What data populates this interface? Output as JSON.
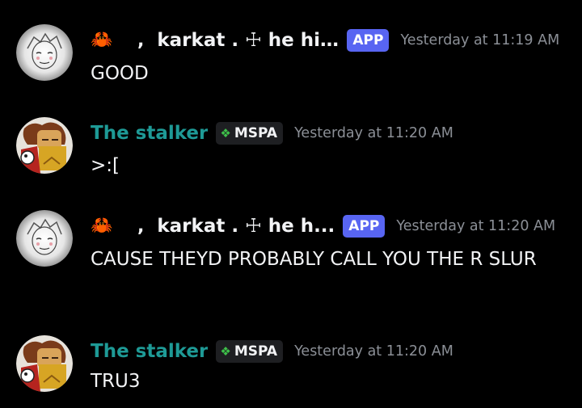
{
  "messages": [
    {
      "author": "karkat . ☩ he hi...",
      "crab_icon": "🦀",
      "comma": ",",
      "badge": "APP",
      "timestamp": "Yesterday at 11:19 AM",
      "text": "GOOD"
    },
    {
      "author": "The stalker",
      "tag_icon": "❖",
      "tag": "MSPA",
      "timestamp": "Yesterday at 11:20 AM",
      "text": ">:["
    },
    {
      "author": "karkat . ☩ he h...",
      "crab_icon": "🦀",
      "comma": ",",
      "badge": "APP",
      "timestamp": "Yesterday at 11:20 AM",
      "text": "CAUSE THEYD PROBABLY CALL YOU THE R SLUR"
    },
    {
      "author": "The stalker",
      "tag_icon": "❖",
      "tag": "MSPA",
      "timestamp": "Yesterday at 11:20 AM",
      "text": "TRU3"
    }
  ],
  "colors": {
    "background": "#000000",
    "text": "#f2f3f5",
    "timestamp": "#8b8f96",
    "stalker_name": "#1e9a96",
    "app_badge": "#5865f2",
    "tag_badge_bg": "#1e1f22",
    "tag_icon": "#3ec14a",
    "crab": "#ff5a1f"
  },
  "icons": {
    "karkat_avatar": "sketch-avatar-icon",
    "stalker_avatar": "character-avatar-icon",
    "crab": "crab-icon",
    "tag": "diamond-tag-icon"
  }
}
